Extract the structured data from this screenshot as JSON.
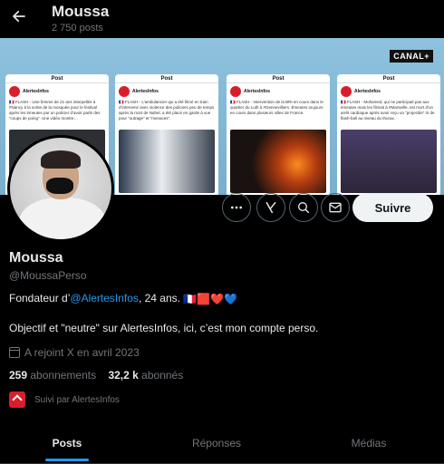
{
  "header": {
    "title": "Moussa",
    "post_count": "2 750 posts"
  },
  "banner": {
    "watermark": "CANAL+",
    "cards": [
      {
        "head": "Post",
        "name": "AlertesInfos",
        "text": "🇫🇷 FLASH - Une femme de 21 ans interpellée à #Nancy à la sortie de la mosquée pour le festival après les émeutes par un policier d’avoir parlé des “coups de poing”. Une vidéo montre…",
        "img": "#2c2f33"
      },
      {
        "head": "Post",
        "name": "AlertesInfos",
        "text": "🇫🇷 FLASH - L’ambulancier qui a été filmé en train d’intervenir avec violence des policiers peu de temps après la mort de Nahel, a été placé en garde à vue pour “outrage” et “menaces”.",
        "img": "#4a4e55"
      },
      {
        "head": "Post",
        "name": "AlertesInfos",
        "text": "🇫🇷 FLASH - Intervention de la BRI en cours dans le quartier du Luth à #Gennevilliers. Émeutes toujours en cours dans plusieurs villes de France.",
        "img": "#2a1a12"
      },
      {
        "head": "Post",
        "name": "AlertesInfos",
        "text": "🇫🇷 FLASH - Mohamed, qui ne participait pas aux émeutes mais les filmait à #Marseille, est mort d’un arrêt cardiaque après avoir reçu un “projectile” tir de flash-ball au niveau du thorax.",
        "img": "#3b3550"
      }
    ]
  },
  "actions": {
    "more_icon": "more-icon",
    "grok_icon": "grok-icon",
    "search_icon": "search-icon",
    "message_icon": "envelope-icon",
    "follow_label": "Suivre"
  },
  "profile": {
    "name": "Moussa",
    "handle": "@MoussaPerso",
    "bio1_prefix": "Fondateur d’",
    "bio1_link": "@AlertesInfos",
    "bio1_suffix": ", 24 ans.",
    "bio1_emojis": "🇫🇷🟥❤️💙",
    "bio2": "Objectif et \"neutre\" sur AlertesInfos, ici, c’est mon compte perso.",
    "joined": "A rejoint X en avril 2023",
    "following_count": "259",
    "following_label": "abonnements",
    "followers_count": "32,2 k",
    "followers_label": "abonnés",
    "followed_by": "Suivi par AlertesInfos"
  },
  "tabs": [
    {
      "label": "Posts",
      "active": true
    },
    {
      "label": "Réponses",
      "active": false
    },
    {
      "label": "Médias",
      "active": false
    }
  ],
  "colors": {
    "accent": "#1d9bf0",
    "background": "#000000",
    "alertes_red": "#d91e2a"
  }
}
